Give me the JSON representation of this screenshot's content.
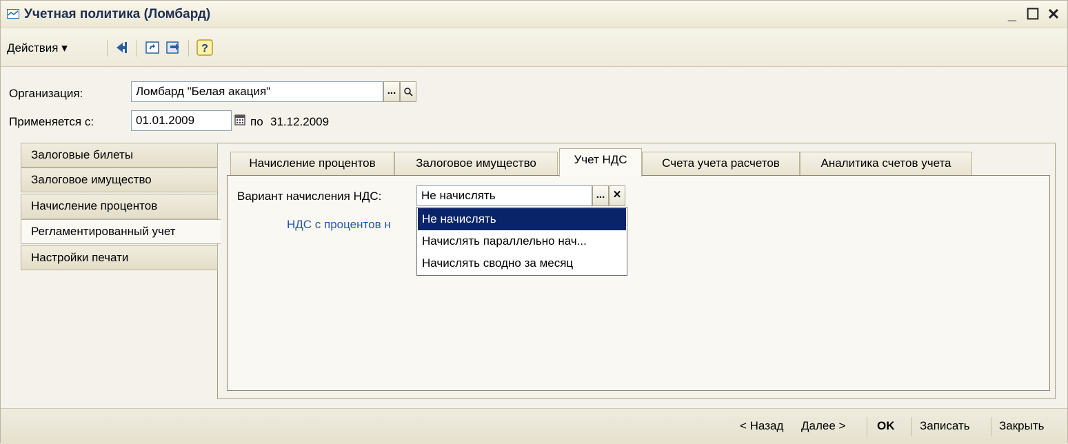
{
  "window": {
    "title": "Учетная политика (Ломбард)",
    "icon": "form-icon",
    "controls": [
      "_",
      "☐",
      "✕"
    ]
  },
  "toolbar": {
    "actions_label": "Действия ▾",
    "icons": [
      "arrow-left-icon",
      "refresh-icon",
      "exchange-icon",
      "help-icon"
    ]
  },
  "form": {
    "org_label": "Организация:",
    "org_value": "Ломбард \"Белая акация\"",
    "applies_label": "Применяется с:",
    "date_from": "01.01.2009",
    "to_label": "по",
    "date_to": "31.12.2009"
  },
  "left_tabs": [
    {
      "label": "Залоговые билеты"
    },
    {
      "label": "Залоговое имущество"
    },
    {
      "label": "Начисление процентов"
    },
    {
      "label": "Регламентированный учет"
    },
    {
      "label": "Настройки печати"
    }
  ],
  "top_tabs": [
    {
      "label": "Начисление процентов"
    },
    {
      "label": "Залоговое имущество"
    },
    {
      "label": "Учет НДС"
    },
    {
      "label": "Счета учета расчетов"
    },
    {
      "label": "Аналитика счетов учета"
    }
  ],
  "vat": {
    "variant_label": "Вариант начисления НДС:",
    "variant_value": "Не начислять",
    "link_text": "НДС с процентов н"
  },
  "dropdown": {
    "options": [
      "Не начислять",
      "Начислять параллельно нач...",
      "Начислять сводно за месяц"
    ]
  },
  "bottom": {
    "back": "< Назад",
    "next": "Далее >",
    "ok": "OK",
    "save": "Записать",
    "close": "Закрыть"
  },
  "colors": {
    "selection": "#0a246a",
    "link": "#2657a8",
    "title_text": "#1e2f52"
  }
}
